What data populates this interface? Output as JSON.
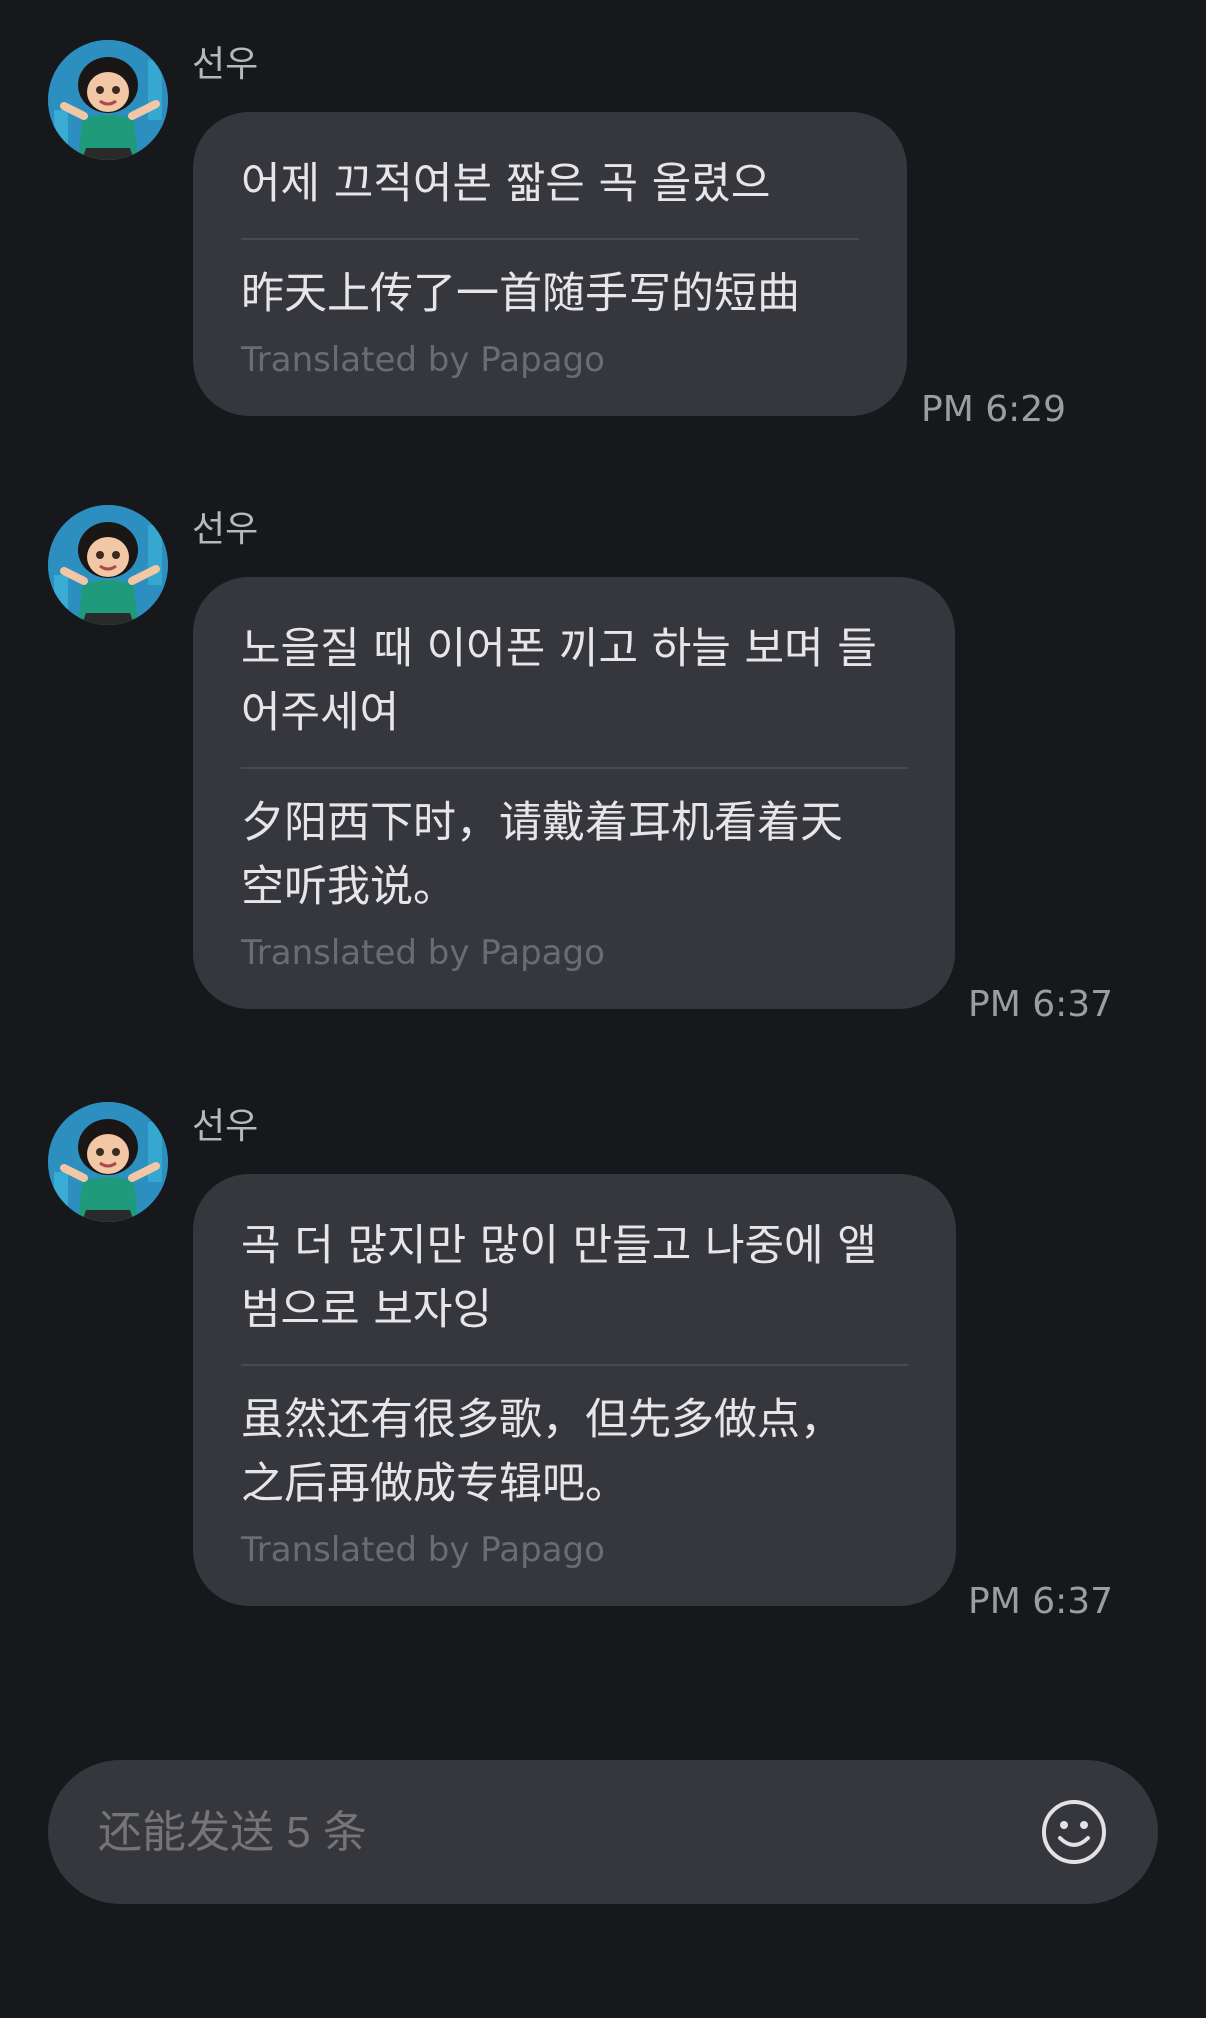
{
  "messages": [
    {
      "sender": "선우",
      "original": "어제 끄적여본 짧은 곡 올렸으",
      "translation": "昨天上传了一首随手写的短曲",
      "translated_note": "Translated by Papago",
      "time": "PM 6:29"
    },
    {
      "sender": "선우",
      "original": "노을질 때 이어폰 끼고 하늘 보며 들\n어주세여",
      "translation": "夕阳西下时，请戴着耳机看着天\n空听我说。",
      "translated_note": "Translated by Papago",
      "time": "PM 6:37"
    },
    {
      "sender": "선우",
      "original": "곡 더 많지만 많이 만들고 나중에 앨\n범으로 보자잉",
      "translation": "虽然还有很多歌，但先多做点，\n之后再做成专辑吧。",
      "translated_note": "Translated by Papago",
      "time": "PM 6:37"
    }
  ],
  "composer": {
    "placeholder": "还能发送 5 条"
  },
  "icons": {
    "avatar": "cartoon-girl-avatar",
    "emoji": "smiley-face-icon"
  }
}
